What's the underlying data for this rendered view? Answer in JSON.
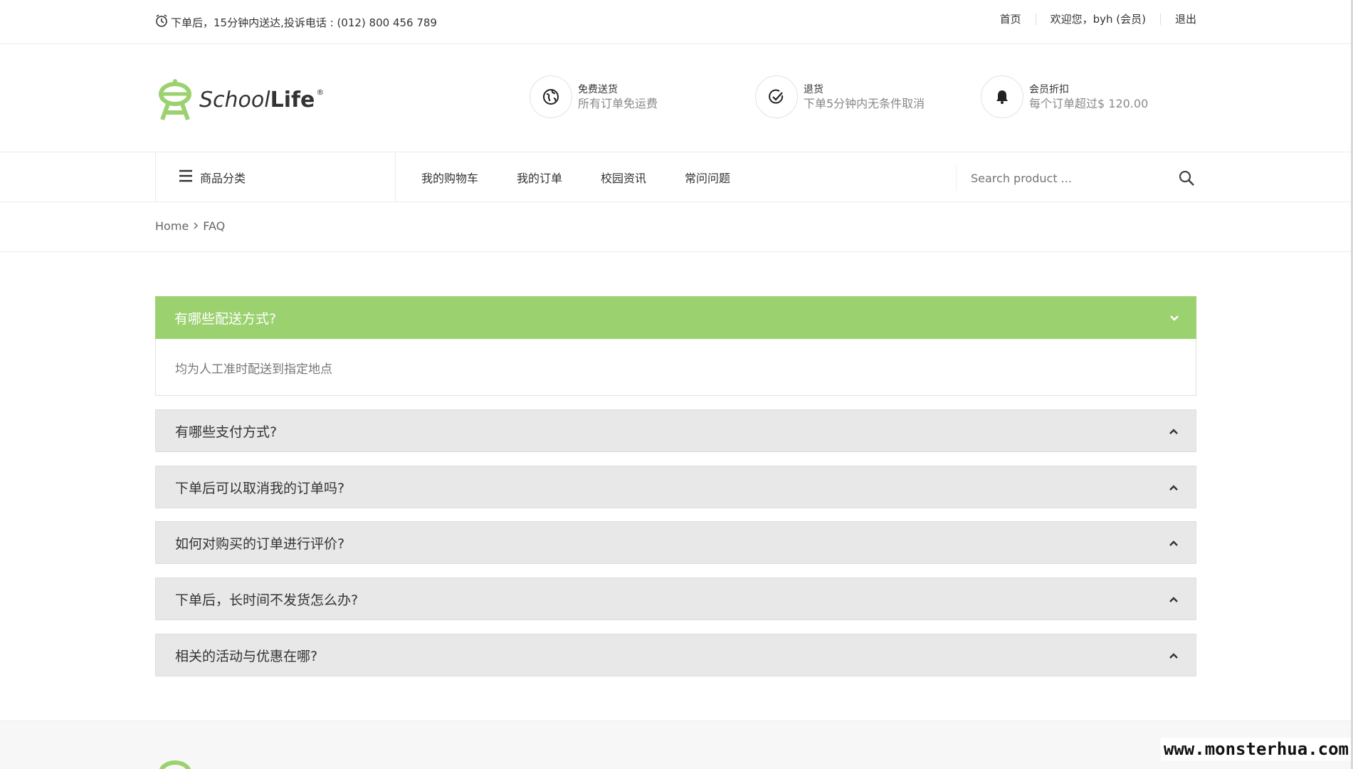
{
  "topbar": {
    "notice": "下单后，15分钟内送达,投诉电话 : (012) 800 456 789",
    "links": [
      "首页",
      "欢迎您，byh (会员)",
      "退出"
    ]
  },
  "logo": {
    "text_a": "School",
    "text_b": "Life",
    "reg": "®"
  },
  "features": [
    {
      "icon": "globe-icon",
      "title": "免费送货",
      "subtitle": "所有订单免运费"
    },
    {
      "icon": "check-circle-icon",
      "title": "退货",
      "subtitle": "下单5分钟内无条件取消"
    },
    {
      "icon": "bell-icon",
      "title": "会员折扣",
      "subtitle": "每个订单超过$ 120.00"
    }
  ],
  "nav": {
    "category": "商品分类",
    "items": [
      "我的购物车",
      "我的订单",
      "校园资讯",
      "常问问题"
    ],
    "search_placeholder": "Search product ..."
  },
  "breadcrumb": {
    "home": "Home",
    "current": "FAQ"
  },
  "faq": [
    {
      "q": "有哪些配送方式?",
      "a": "均为人工准时配送到指定地点",
      "open": true
    },
    {
      "q": "有哪些支付方式?",
      "open": false
    },
    {
      "q": "下单后可以取消我的订单吗?",
      "open": false
    },
    {
      "q": "如何对购买的订单进行评价?",
      "open": false
    },
    {
      "q": "下单后，长时间不发货怎么办?",
      "open": false
    },
    {
      "q": "相关的活动与优惠在哪?",
      "open": false
    }
  ],
  "watermark": "www.monsterhua.com",
  "colors": {
    "accent": "#9bd16e",
    "closed_bg": "#e8e8e8"
  }
}
